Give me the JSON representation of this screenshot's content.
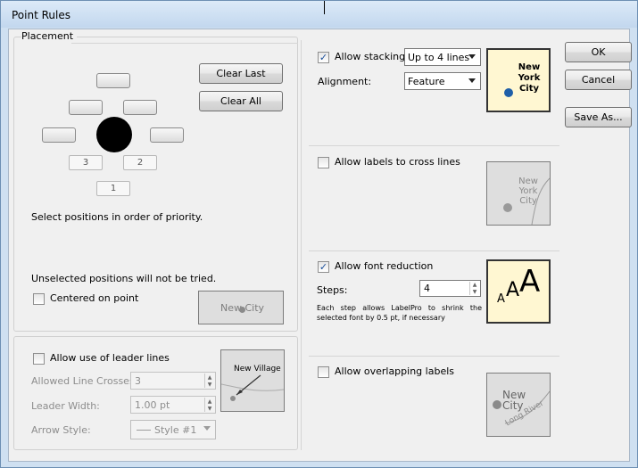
{
  "window": {
    "title": "Point Rules"
  },
  "placement": {
    "group_label": "Placement",
    "clear_last": "Clear Last",
    "clear_all": "Clear All",
    "positions": {
      "p1": "1",
      "p2": "2",
      "p3": "3"
    },
    "instruction": "Select positions in order of priority.",
    "unselected_note": "Unselected positions will not be tried.",
    "centered_label": "Centered on point",
    "centered_checked": false,
    "centered_preview_text": "New City"
  },
  "leader": {
    "checkbox_label": "Allow use of leader lines",
    "checked": false,
    "crosses_label": "Allowed Line Crosses:",
    "crosses_value": "3",
    "width_label": "Leader Width:",
    "width_value": "1.00 pt",
    "arrow_label": "Arrow Style:",
    "arrow_value": "Style #1",
    "preview_text": "New Village"
  },
  "stacking": {
    "checkbox_label": "Allow stacking",
    "checked": true,
    "lines_value": "Up to 4 lines",
    "alignment_label": "Alignment:",
    "alignment_value": "Feature",
    "preview_lines": [
      "New",
      "York",
      "City"
    ]
  },
  "cross_lines": {
    "checkbox_label": "Allow labels to cross lines",
    "checked": false,
    "preview_lines": [
      "New",
      "York",
      "City"
    ]
  },
  "font_reduction": {
    "checkbox_label": "Allow font reduction",
    "checked": true,
    "steps_label": "Steps:",
    "steps_value": "4",
    "description": "Each step allows LabelPro to shrink the selected font by 0.5 pt, if necessary",
    "preview_glyphs": [
      "A",
      "A",
      "A"
    ]
  },
  "overlap": {
    "checkbox_label": "Allow overlapping labels",
    "checked": false,
    "preview_lines": [
      "New",
      "City"
    ],
    "preview_river": "Long River"
  },
  "buttons": {
    "ok": "OK",
    "cancel": "Cancel",
    "save_as": "Save As..."
  },
  "colors": {
    "point_blue": "#1f5fa8",
    "point_grey": "#9a9a9a",
    "preview_yellow": "#fff7d2"
  }
}
